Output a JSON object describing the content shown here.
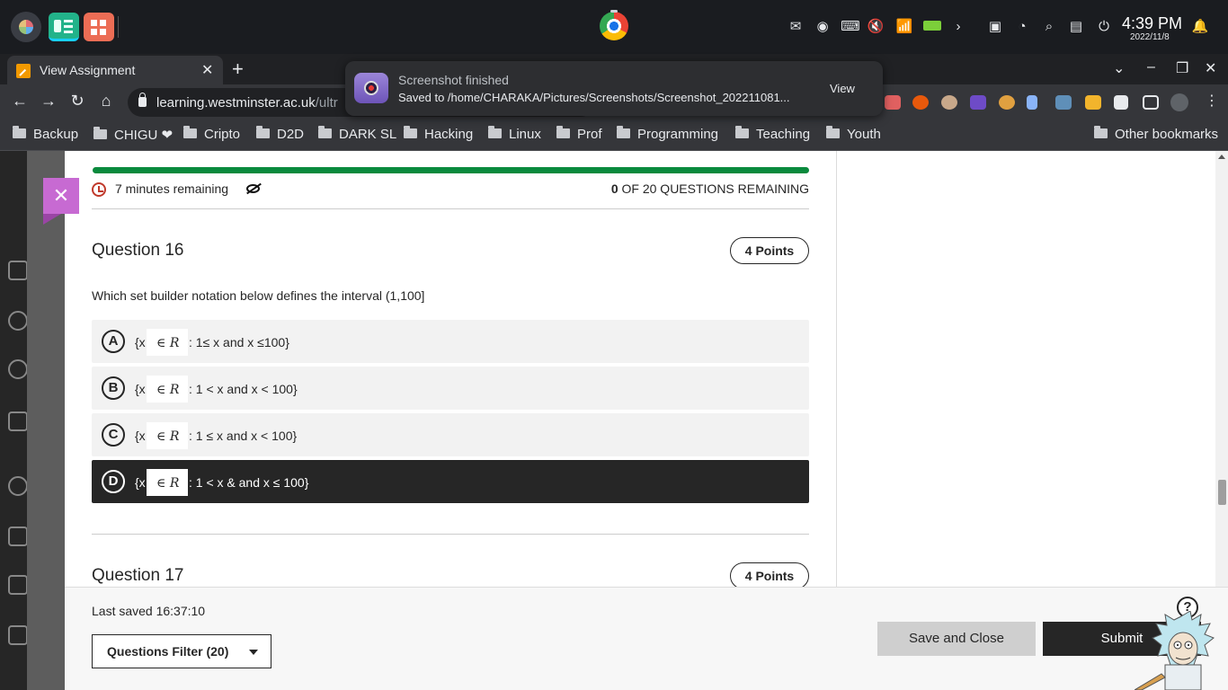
{
  "os": {
    "clock_time": "4:39 PM",
    "clock_date": "2022/11/8"
  },
  "browser": {
    "tab_title": "View Assignment",
    "tab_close": "✕",
    "new_tab": "+",
    "url_host": "learning.westminster.ac.uk",
    "url_path": "/ultr",
    "bookmarks": [
      "Backup",
      "CHIGU ❤",
      "Cripto",
      "D2D",
      "DARK SL",
      "Hacking",
      "Linux",
      "Prof",
      "Programming",
      "Teaching",
      "Youth"
    ],
    "other_bookmarks": "Other bookmarks"
  },
  "notification": {
    "title": "Screenshot finished",
    "body": "Saved to /home/CHARAKA/Pictures/Screenshots/Screenshot_202211081...",
    "action": "View"
  },
  "assessment": {
    "progress": 1.0,
    "timer_text": "7 minutes remaining",
    "remaining_count": "0",
    "remaining_text": "OF 20 QUESTIONS REMAINING",
    "accent_color": "#0a8a3d"
  },
  "question16": {
    "title": "Question 16",
    "points": "4 Points",
    "text": "Which set builder notation below defines the interval (1,100]",
    "options": [
      {
        "letter": "A",
        "pre": "{x",
        "math_symbol": "∈",
        "math_var": "R",
        "rest": ": 1≤ x and x ≤100}",
        "selected": false
      },
      {
        "letter": "B",
        "pre": "{x",
        "math_symbol": "∈",
        "math_var": "R",
        "rest": ": 1 < x and x < 100}",
        "selected": false
      },
      {
        "letter": "C",
        "pre": "{x",
        "math_symbol": "∈",
        "math_var": "R",
        "rest": ": 1 ≤ x and x < 100}",
        "selected": false
      },
      {
        "letter": "D",
        "pre": "{x",
        "math_symbol": "∈",
        "math_var": "R",
        "rest": ": 1 < x & and x ≤ 100}",
        "selected": true
      }
    ]
  },
  "question17": {
    "title": "Question 17",
    "points": "4 Points"
  },
  "footer": {
    "last_saved": "Last saved 16:37:10",
    "filter_label": "Questions Filter (20)",
    "save_close_label": "Save and Close",
    "submit_label": "Submit"
  },
  "help": "?"
}
